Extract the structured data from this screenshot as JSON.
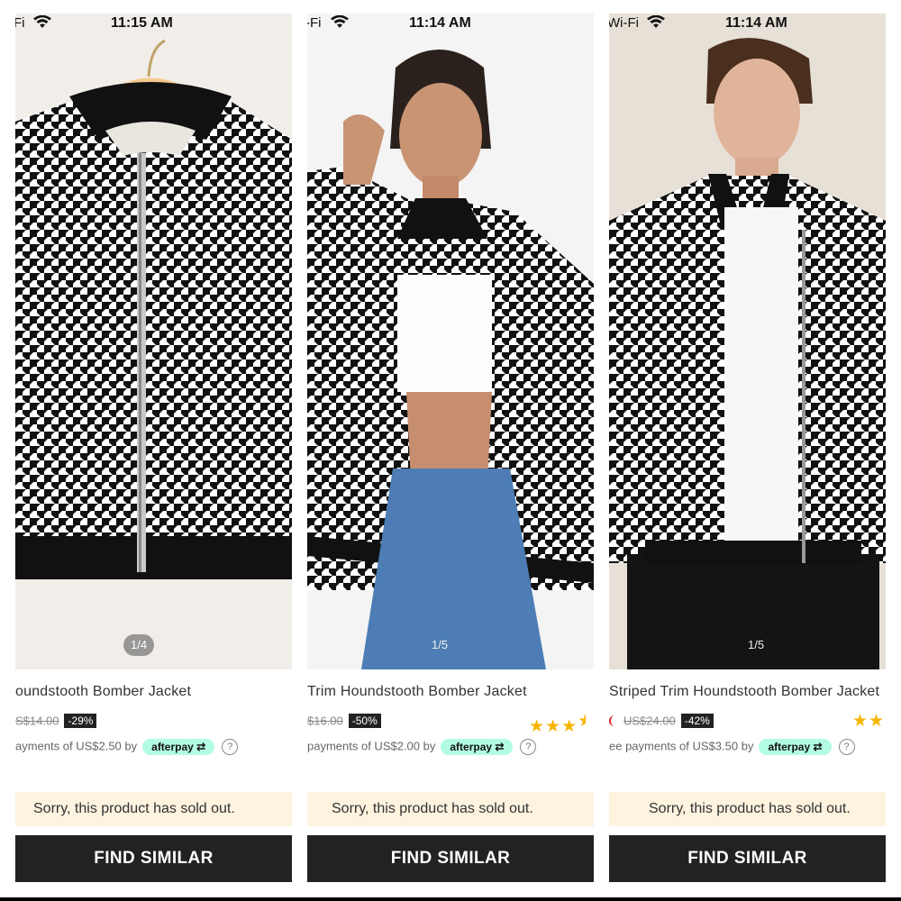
{
  "panels": [
    {
      "status": {
        "wifi_label": "Fi",
        "time": "11:15 AM"
      },
      "image_counter": "1/4",
      "title": "oundstooth Bomber Jacket",
      "old_price": "S$14.00",
      "discount": "-29%",
      "afterpay_text": "ayments of US$2.50 by",
      "afterpay_label": "afterpay",
      "sold_out": "Sorry, this product has sold out.",
      "button": "FIND SIMILAR"
    },
    {
      "status": {
        "wifi_label": "-Fi",
        "time": "11:14 AM"
      },
      "image_counter": "1/5",
      "title": "Trim Houndstooth Bomber Jacket",
      "old_price": "$16.00",
      "discount": "-50%",
      "rating_stars": 3.5,
      "afterpay_text": "payments of US$2.00 by",
      "afterpay_label": "afterpay",
      "sold_out": "Sorry, this product has sold out.",
      "button": "FIND SIMILAR"
    },
    {
      "status": {
        "wifi_label": "Wi-Fi",
        "time": "11:14 AM"
      },
      "image_counter": "1/5",
      "title": "Striped Trim Houndstooth Bomber Jacket",
      "old_price": "US$24.00",
      "discount": "-42%",
      "rating_stars": 2,
      "afterpay_text": "ee payments of US$3.50 by",
      "afterpay_label": "afterpay",
      "sold_out": "Sorry, this product has sold out.",
      "button": "FIND SIMILAR"
    }
  ],
  "colors": {
    "button_bg": "#222222",
    "soldout_bg": "#fdf3df",
    "afterpay_mint": "#b2fce4",
    "star": "#f7b500"
  }
}
